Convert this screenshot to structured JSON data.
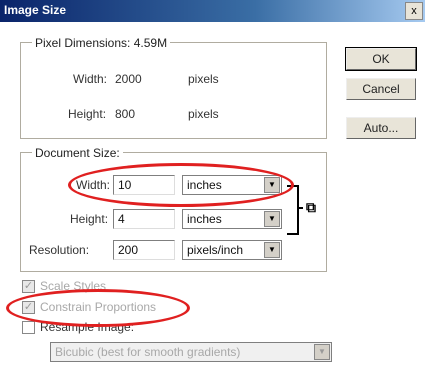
{
  "window": {
    "title": "Image Size",
    "close_glyph": "x"
  },
  "pixel_dimensions": {
    "legend": "Pixel Dimensions:",
    "size": "4.59M",
    "width_label": "Width:",
    "width_value": "2000",
    "width_unit": "pixels",
    "height_label": "Height:",
    "height_value": "800",
    "height_unit": "pixels"
  },
  "document_size": {
    "legend": "Document Size:",
    "width_label": "Width:",
    "width_value": "10",
    "width_unit": "inches",
    "height_label": "Height:",
    "height_value": "4",
    "height_unit": "inches",
    "resolution_label": "Resolution:",
    "resolution_value": "200",
    "resolution_unit": "pixels/inch"
  },
  "options": {
    "scale_styles": "Scale Styles",
    "scale_styles_checked": true,
    "constrain_proportions": "Constrain Proportions",
    "constrain_proportions_checked": true,
    "resample_image_label": "Resample Image:",
    "resample_image_checked": false,
    "resample_method": "Bicubic (best for smooth gradients)"
  },
  "buttons": {
    "ok": "OK",
    "cancel": "Cancel",
    "auto": "Auto..."
  },
  "icons": {
    "close": "close-icon",
    "dropdown": "chevron-down-icon",
    "link": "chain-link-icon",
    "check": "check-icon"
  },
  "colors": {
    "titlebar_start": "#0a246a",
    "titlebar_end": "#a6caf0",
    "highlight_circle": "#e02020"
  }
}
